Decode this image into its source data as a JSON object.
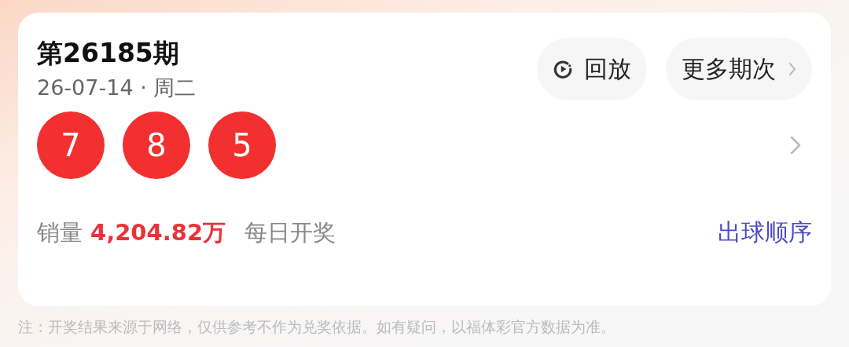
{
  "draw": {
    "title": "第26185期",
    "date": "26-07-14 · 周二"
  },
  "buttons": [
    {
      "kind": "replay",
      "label": "回放"
    },
    {
      "kind": "more",
      "label": "更多期次"
    }
  ],
  "balls": [
    "7",
    "8",
    "5"
  ],
  "sales": {
    "label": "销量",
    "value": "4,204.82万",
    "frequency": "每日开奖"
  },
  "order_link": "出球顺序",
  "note": "注：开奖结果来源于网络，仅供参考不作为兑奖依据。如有疑问，以福体彩官方数据为准。"
}
